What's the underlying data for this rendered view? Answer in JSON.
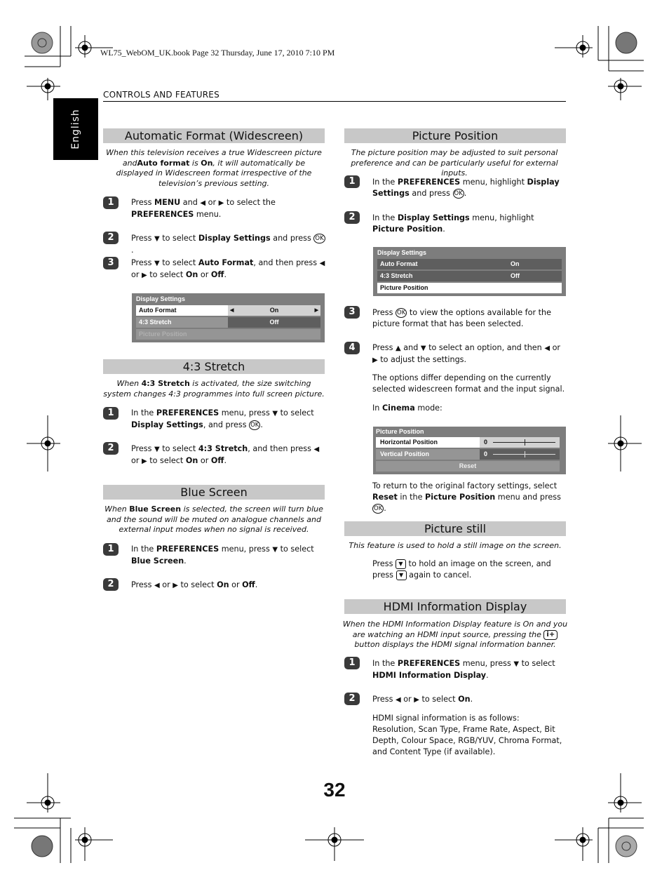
{
  "printer_line": "WL75_WebOM_UK.book  Page 32  Thursday, June 17, 2010  7:10 PM",
  "header": {
    "section": "CONTROLS AND FEATURES",
    "language_tab": "English"
  },
  "page_number": "32",
  "icons": {
    "ok_button": "OK",
    "info_button": "i+",
    "freeze_button": "▼",
    "up": "▲",
    "down": "▼",
    "left": "◀",
    "right": "▶"
  },
  "auto_format": {
    "title": "Automatic Format (Widescreen)",
    "intro": [
      "When this television receives a true Widescreen picture and",
      "Auto format",
      " is ",
      "On",
      ", it will automatically be displayed in Widescreen format irrespective of the television’s previous setting."
    ],
    "steps": [
      {
        "n": "1",
        "parts": [
          "Press ",
          "MENU",
          " and ",
          "◀",
          " or ",
          "▶",
          " to select the ",
          "PREFERENCES",
          " menu."
        ]
      },
      {
        "n": "2",
        "parts": [
          "Press ",
          "▼",
          " to select ",
          "Display Settings",
          " and press ",
          "OK",
          "."
        ]
      },
      {
        "n": "3",
        "parts": [
          "Press ",
          "▼",
          " to select ",
          "Auto Format",
          ", and then press ",
          "◀",
          " or ",
          "▶",
          " to select ",
          "On",
          " or ",
          "Off",
          "."
        ]
      }
    ],
    "menu": {
      "title": "Display Settings",
      "rows": [
        {
          "label": "Auto Format",
          "value": "On",
          "state": "selected"
        },
        {
          "label": "4:3 Stretch",
          "value": "Off",
          "state": "normal"
        },
        {
          "label": "Picture Position",
          "value": "",
          "state": "disabled"
        }
      ]
    }
  },
  "stretch": {
    "title": "4:3 Stretch",
    "intro": [
      "When ",
      "4:3 Stretch",
      " is activated, the size switching system changes 4:3 programmes into full screen picture."
    ],
    "steps": [
      {
        "n": "1",
        "parts": [
          "In the ",
          "PREFERENCES",
          " menu, press ",
          "▼",
          " to select ",
          "Display Settings",
          ", and press ",
          "OK",
          "."
        ]
      },
      {
        "n": "2",
        "parts": [
          "Press ",
          "▼",
          " to select ",
          "4:3 Stretch",
          ", and then press ",
          "◀",
          " or ",
          "▶",
          " to select ",
          "On",
          " or ",
          "Off",
          "."
        ]
      }
    ]
  },
  "blue_screen": {
    "title": "Blue Screen",
    "intro": [
      "When ",
      "Blue Screen",
      " is selected, the screen will turn blue and the sound will be muted on analogue channels and external input modes when no signal is received."
    ],
    "steps": [
      {
        "n": "1",
        "parts": [
          "In the ",
          "PREFERENCES",
          " menu, press ",
          "▼",
          " to select ",
          "Blue Screen",
          "."
        ]
      },
      {
        "n": "2",
        "parts": [
          "Press ",
          "◀",
          " or ",
          "▶",
          " to select ",
          "On",
          " or ",
          "Off",
          "."
        ]
      }
    ]
  },
  "picture_position": {
    "title": "Picture Position",
    "intro": "The picture position may be adjusted to suit personal preference and can be particularly useful for external inputs.",
    "steps": [
      {
        "n": "1",
        "parts": [
          "In the ",
          "PREFERENCES",
          " menu, highlight ",
          "Display Settings",
          " and press ",
          "OK",
          "."
        ]
      },
      {
        "n": "2",
        "parts": [
          "In the ",
          "Display Settings",
          " menu, highlight ",
          "Picture Position",
          "."
        ]
      },
      {
        "n": "3",
        "parts": [
          "Press ",
          "OK",
          " to view the options available for the picture format that has been selected."
        ]
      },
      {
        "n": "4",
        "parts": [
          "Press ",
          "▲",
          " and ",
          "▼",
          " to select an option, and then ",
          "◀",
          " or ",
          "▶",
          " to adjust the settings."
        ]
      }
    ],
    "menu": {
      "title": "Display Settings",
      "rows": [
        {
          "label": "Auto Format",
          "value": "On",
          "state": "normal"
        },
        {
          "label": "4:3 Stretch",
          "value": "Off",
          "state": "normal"
        },
        {
          "label": "Picture Position",
          "value": "",
          "state": "selected"
        }
      ]
    },
    "options_note": "The options differ depending on the currently selected widescreen format and the input signal.",
    "cinema_note": [
      "In ",
      "Cinema",
      " mode:"
    ],
    "position_menu": {
      "title": "Picture Position",
      "rows": [
        {
          "label": "Horizontal Position",
          "value": "0",
          "slider_fraction": 0.5,
          "state": "selected"
        },
        {
          "label": "Vertical Position",
          "value": "0",
          "slider_fraction": 0.5,
          "state": "normal"
        }
      ],
      "reset_label": "Reset"
    },
    "reset_note": [
      "To return to the original factory settings, select ",
      "Reset",
      " in the ",
      "Picture Position",
      " menu and press ",
      "OK",
      "."
    ]
  },
  "picture_still": {
    "title": "Picture still",
    "intro": "This feature is used to hold a still image on the screen.",
    "body": [
      "Press ",
      "▼",
      " to hold an image on the screen, and press ",
      "▼",
      " again to cancel."
    ]
  },
  "hdmi_info": {
    "title": "HDMI Information Display",
    "intro": [
      "When the HDMI Information Display feature is On and you are watching an HDMI input source, pressing the ",
      "i+",
      " button displays the HDMI signal information banner."
    ],
    "steps": [
      {
        "n": "1",
        "parts": [
          "In the ",
          "PREFERENCES",
          " menu, press ",
          "▼",
          " to select ",
          "HDMI Information Display",
          "."
        ]
      },
      {
        "n": "2",
        "parts": [
          "Press ",
          "◀",
          " or ",
          "▶",
          " to select ",
          "On",
          "."
        ]
      }
    ],
    "signal_note_title": "HDMI signal information is as follows:",
    "signal_note_body": "Resolution, Scan Type, Frame Rate, Aspect, Bit Depth, Colour Space, RGB/YUV, Chroma Format, and Content Type (if available)."
  }
}
